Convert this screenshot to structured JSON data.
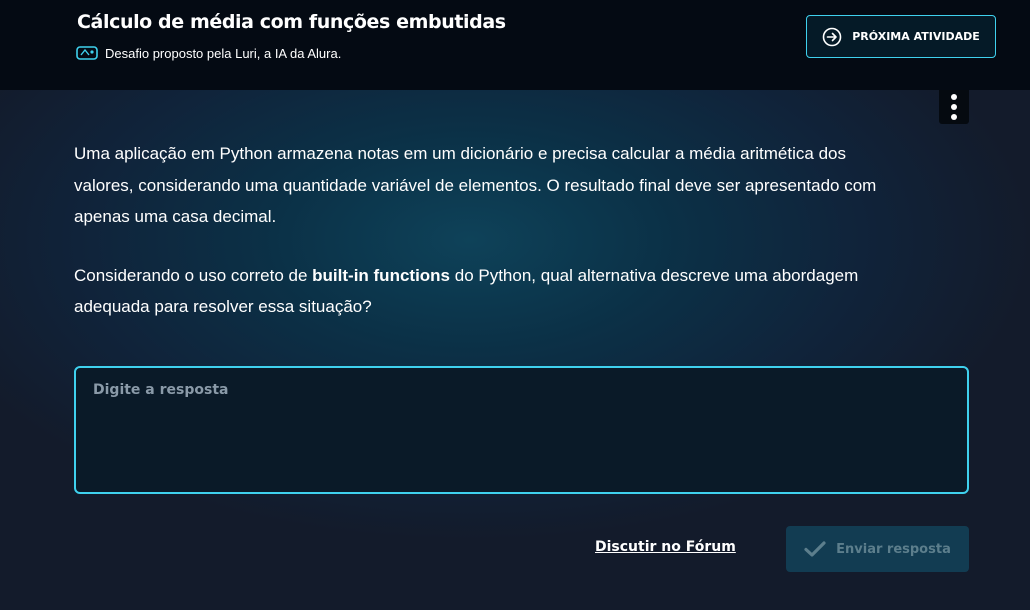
{
  "header": {
    "title": "Cálculo de média com funções embutidas",
    "subtitle": "Desafio proposto pela Luri, a IA da Alura.",
    "next_button_label": "PRÓXIMA ATIVIDADE"
  },
  "question": {
    "paragraph1": "Uma aplicação em Python armazena notas em um dicionário e precisa calcular a média aritmética dos valores, considerando uma quantidade variável de elementos. O resultado final deve ser apresentado com apenas uma casa decimal.",
    "paragraph2_before": "Considerando o uso correto de ",
    "paragraph2_bold": "built-in functions",
    "paragraph2_after": " do Python, qual alternativa descreve uma abordagem adequada para resolver essa situação?"
  },
  "answer": {
    "placeholder": "Digite a resposta",
    "value": ""
  },
  "actions": {
    "forum_link": "Discutir no Fórum",
    "send_button_label": "Enviar resposta"
  },
  "icons": {
    "next": "arrow-right-circle-icon",
    "luri": "luri-badge-icon",
    "menu": "kebab-menu-icon",
    "send": "checkmark-icon"
  },
  "colors": {
    "accent": "#3fd1ee",
    "header_bg": "#040a13",
    "send_disabled_bg": "#123c52",
    "send_disabled_text": "#5c7e8c"
  }
}
